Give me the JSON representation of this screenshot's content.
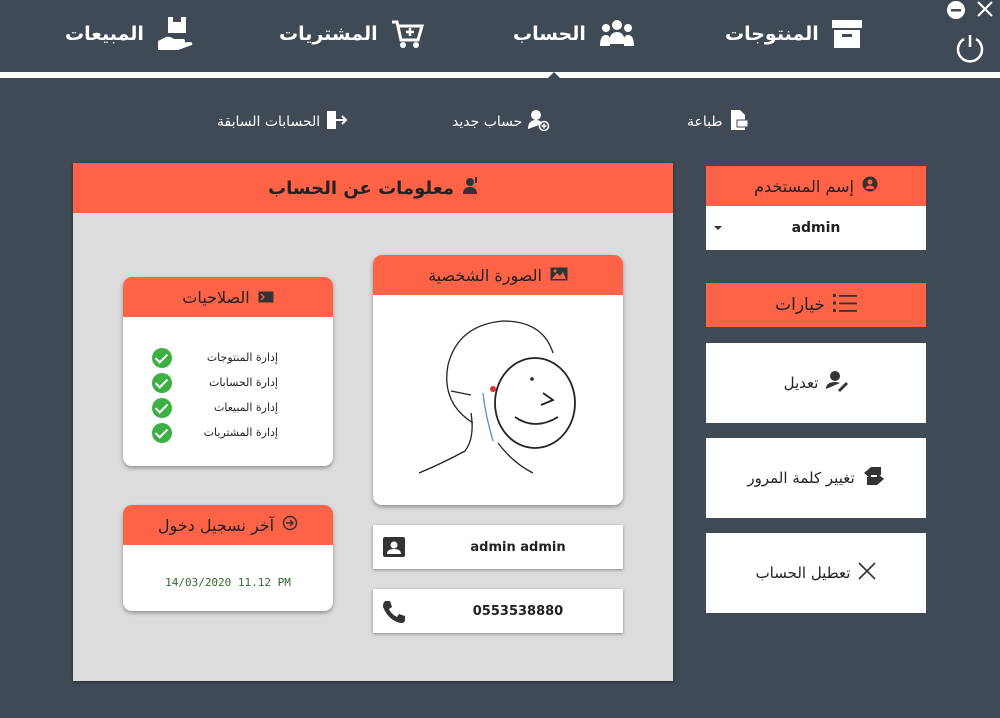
{
  "nav": {
    "products": "المنتوجات",
    "account": "الحساب",
    "purchases": "المشتريات",
    "sales": "المبيعات"
  },
  "subnav": {
    "print": "طباعة",
    "new_account": "حساب جديد",
    "previous_accounts": "الحسابات السابقة"
  },
  "account_info": {
    "title": "معلومات عن الحساب",
    "photo_title": "الصورة الشخصية",
    "permissions_title": "الصلاحيات",
    "permissions": [
      {
        "label": "إدارة المنتوجات",
        "granted": true
      },
      {
        "label": "إدارة الحسابات",
        "granted": true
      },
      {
        "label": "إدارة المبيعات",
        "granted": true
      },
      {
        "label": "إدارة المشتريات",
        "granted": true
      }
    ],
    "last_login_title": "آخر نسجيل دخول",
    "last_login_value": "14/03/2020 11.12 PM",
    "full_name": "admin admin",
    "phone": "0553538880"
  },
  "sidebar": {
    "username_label": "إسم المستخدم",
    "username_value": "admin",
    "options_label": "خيارات",
    "edit": "تعديل",
    "change_password": "تغيير كلمة المرور",
    "disable_account": "تعطيل الحساب"
  },
  "colors": {
    "background": "#3f4a54",
    "accent": "#ff6347",
    "panel": "#dcdcdc",
    "check": "#3cb043"
  }
}
